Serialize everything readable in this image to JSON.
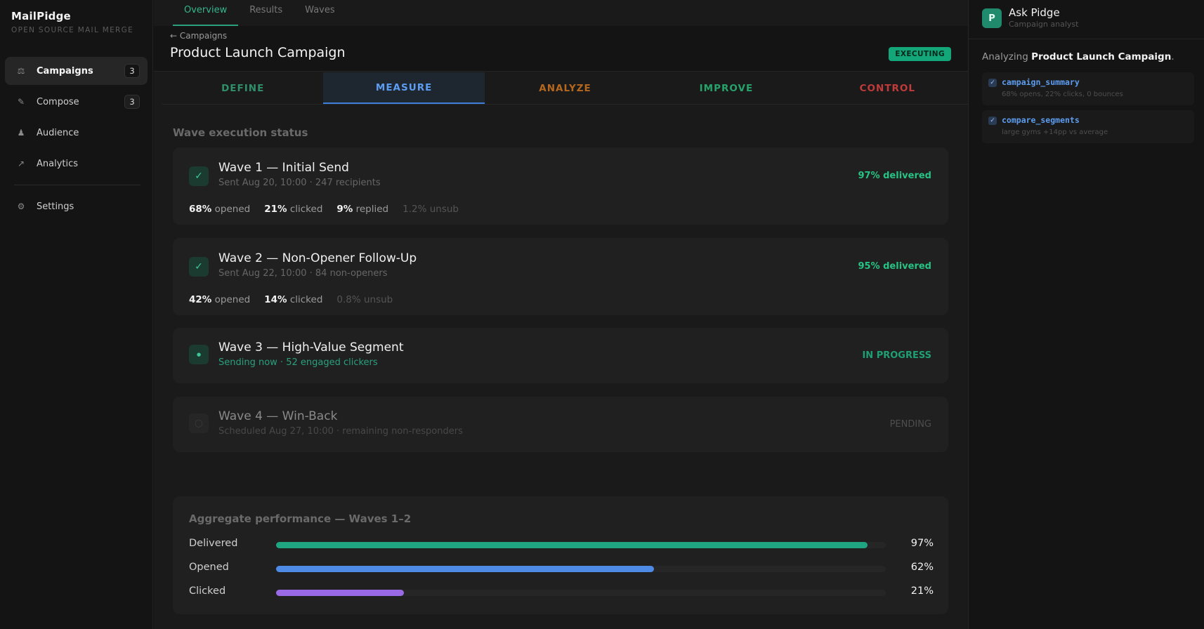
{
  "brand": {
    "name": "MailPidge",
    "tagline": "OPEN SOURCE MAIL MERGE"
  },
  "sidebar": {
    "items": [
      {
        "icon": "scales-icon",
        "glyph": "⚖",
        "label": "Campaigns",
        "badge": "3",
        "active": true
      },
      {
        "icon": "pencil-icon",
        "glyph": "✎",
        "label": "Compose",
        "badge": "3",
        "active": false
      },
      {
        "icon": "person-icon",
        "glyph": "♟",
        "label": "Audience",
        "badge": "",
        "active": false
      },
      {
        "icon": "trend-arrow-icon",
        "glyph": "↗",
        "label": "Analytics",
        "badge": "",
        "active": false
      }
    ],
    "settings": {
      "icon": "gear-icon",
      "glyph": "⚙",
      "label": "Settings"
    }
  },
  "top_tabs": [
    "Overview",
    "Results",
    "Waves"
  ],
  "header": {
    "breadcrumb": "← Campaigns",
    "title": "Product Launch Campaign",
    "status": "EXECUTING",
    "status_color": "#12a679"
  },
  "phases": [
    {
      "label": "DEFINE",
      "color": "#2f8f6a"
    },
    {
      "label": "MEASURE",
      "color": "#5d9df0"
    },
    {
      "label": "ANALYZE",
      "color": "#b5671e"
    },
    {
      "label": "IMPROVE",
      "color": "#26a36b"
    },
    {
      "label": "CONTROL",
      "color": "#c23a3a"
    }
  ],
  "section_title": "Wave execution status",
  "waves": [
    {
      "title": "Wave 1 — Initial Send",
      "subtitle": "Sent Aug 20, 10:00 · 247 recipients",
      "status": "97% delivered",
      "state": "done",
      "metrics": [
        {
          "value": "68%",
          "label": "opened"
        },
        {
          "value": "21%",
          "label": "clicked"
        },
        {
          "value": "9%",
          "label": "replied"
        }
      ],
      "unsub": "1.2% unsub"
    },
    {
      "title": "Wave 2 — Non-Opener Follow-Up",
      "subtitle": "Sent Aug 22, 10:00 · 84 non-openers",
      "status": "95% delivered",
      "state": "done",
      "metrics": [
        {
          "value": "42%",
          "label": "opened"
        },
        {
          "value": "14%",
          "label": "clicked"
        }
      ],
      "unsub": "0.8% unsub"
    },
    {
      "title": "Wave 3 — High-Value Segment",
      "subtitle": "Sending now · 52 engaged clickers",
      "status": "IN PROGRESS",
      "state": "progress"
    },
    {
      "title": "Wave 4 — Win-Back",
      "subtitle": "Scheduled Aug 27, 10:00 · remaining non-responders",
      "status": "PENDING",
      "state": "pending"
    }
  ],
  "aggregate": {
    "title": "Aggregate performance — Waves 1–2",
    "bars": [
      {
        "label": "Delivered",
        "value": "97%",
        "fraction": 0.97,
        "color": "#20a583"
      },
      {
        "label": "Opened",
        "value": "62%",
        "fraction": 0.62,
        "color": "#4d8be6"
      },
      {
        "label": "Clicked",
        "value": "21%",
        "fraction": 0.21,
        "color": "#9a6ae6"
      }
    ]
  },
  "assistant": {
    "avatar_letter": "P",
    "name": "Ask Pidge",
    "role": "Campaign analyst",
    "message_prefix": "Analyzing ",
    "message_subject": "Product Launch Campaign",
    "message_suffix": ".",
    "tools": [
      {
        "name": "campaign_summary",
        "desc": "68% opens, 22% clicks, 0 bounces"
      },
      {
        "name": "compare_segments",
        "desc": "large gyms +14pp vs average"
      }
    ]
  }
}
